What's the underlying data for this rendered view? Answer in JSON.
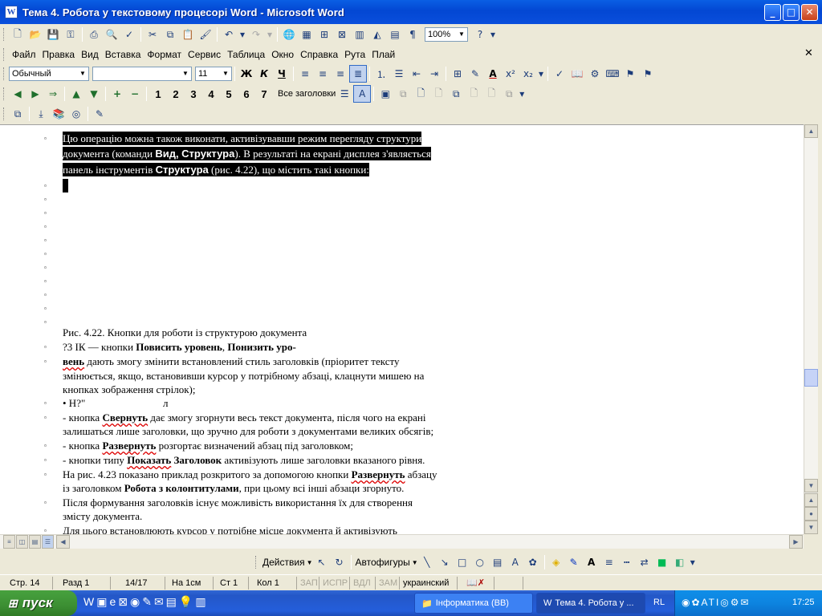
{
  "window": {
    "title": "Тема 4. Робота у текстовому процесорі Word - Microsoft Word"
  },
  "menu": [
    "Файл",
    "Правка",
    "Вид",
    "Вставка",
    "Формат",
    "Сервис",
    "Таблица",
    "Окно",
    "Справка",
    "Рута",
    "Плай"
  ],
  "standard": {
    "zoom": "100%"
  },
  "formatting": {
    "style": "Обычный",
    "font": "",
    "size": "11"
  },
  "outline": {
    "levels": [
      "1",
      "2",
      "3",
      "4",
      "5",
      "6",
      "7"
    ],
    "show_headings": "Все заголовки"
  },
  "document": {
    "selected_lines": [
      "Цю операцію можна також виконати, активізувавши режим перегляду структури",
      "документа (команди ",
      "Вид, Структура",
      "). В результаті на екрані дисплея з'являється",
      "панель інструментів ",
      "Структура",
      " (рис. 4.22), що містить такі кнопки:"
    ],
    "caption": "Рис. 4.22. Кнопки для роботи із структурою документа",
    "line_q": "?3 ІК — кнопки ",
    "line_q_b1": "Повисить уровень",
    "line_q_b2": "Понизить уро-",
    "line_v1": "вень",
    "line_v1_rest": " дають змогу змінити встановлений стиль заголовків (пріоритет тексту",
    "line_v2": "змінюється, якщо, встановивши курсор у потрібному абзаці, клацнути мишею на",
    "line_v3": "кнопках зображення стрілок);",
    "line_h": "• Н?\"",
    "line_h2": "л",
    "line_c1a": "- кнопка ",
    "line_c1b": "Свернуть",
    "line_c1c": " дає змогу згорнути весь текст документа, після чого на екрані",
    "line_c2": "залишаться лише заголовки, що зручно для роботи з документами великих обсягів;",
    "line_r1a": "- кнопка ",
    "line_r1b": "Развернуть",
    "line_r1c": " розгортає визначений абзац під заголовком;",
    "line_s1a": "- кнопки типу ",
    "line_s1b": "Показать",
    "line_s1c": " ",
    "line_s1d": "Заголовок",
    "line_s1e": " активізують лише заголовки вказаного рівня.",
    "line_n1a": "На рис. 4.23 показано приклад розкритого за допомогою кнопки ",
    "line_n1b": "Развернуть",
    "line_n1c": " абзацу",
    "line_n2a": "із заголовком ",
    "line_n2b": "Робота з колонтитулами",
    "line_n2c": ", при цьому всі інші абзаци згорнуто.",
    "line_p1": "Після формування заголовків існує можливість використання їх для створення",
    "line_p2": "змісту документа.",
    "line_d1": "Для цього встановлюють курсор у потрібне місце документа й активізують"
  },
  "drawing": {
    "actions": "Действия",
    "autoshapes": "Автофигуры"
  },
  "status": {
    "page": "Стр. 14",
    "section": "Разд 1",
    "pages": "14/17",
    "at": "На 1см",
    "line": "Ст 1",
    "col": "Кол 1",
    "rec": "ЗАП",
    "trk": "ИСПР",
    "ext": "ВДЛ",
    "ovr": "ЗАМ",
    "lang": "украинский"
  },
  "taskbar": {
    "start": "пуск",
    "tasks": [
      "Інформатика (ВВ)",
      "Тема 4. Робота у ..."
    ],
    "lang": "RL",
    "time": "17:25"
  }
}
